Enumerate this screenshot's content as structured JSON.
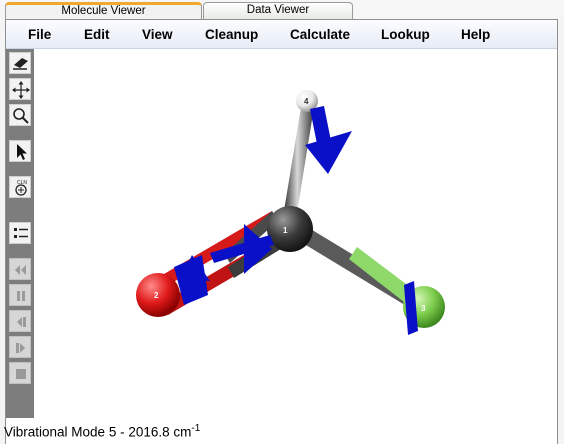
{
  "tabs": [
    {
      "label": "Molecule Viewer",
      "active": true
    },
    {
      "label": "Data Viewer",
      "active": false
    }
  ],
  "menu": {
    "items": [
      "File",
      "Edit",
      "View",
      "Cleanup",
      "Calculate",
      "Lookup",
      "Help"
    ]
  },
  "toolbar": {
    "buttons": [
      {
        "icon": "eraser-icon"
      },
      {
        "icon": "move-arrows-icon"
      },
      {
        "icon": "zoom-magnifier-icon"
      },
      {
        "icon": "select-arrow-icon"
      },
      {
        "icon": "clean-structure-icon"
      },
      {
        "icon": "list-icon"
      },
      {
        "icon": "rewind-icon"
      },
      {
        "icon": "pause-icon"
      },
      {
        "icon": "step-back-icon"
      },
      {
        "icon": "step-forward-icon"
      },
      {
        "icon": "stop-icon"
      }
    ]
  },
  "molecule": {
    "atoms": [
      {
        "label": "1",
        "color": "#3c3c3c"
      },
      {
        "label": "2",
        "color": "#e11b1b"
      },
      {
        "label": "3",
        "color": "#7fcf4f"
      },
      {
        "label": "4",
        "color": "#f2f2f2"
      }
    ],
    "vector_color": "#0a10c8"
  },
  "status": {
    "prefix": "Vibrational Mode 5 - 2016.8 cm",
    "superscript": "-1"
  },
  "colors": {
    "active_tab_accent": "#f0a92e",
    "toolbar_background": "#7d7d7d",
    "menubar_background": "#e6ecf6"
  }
}
